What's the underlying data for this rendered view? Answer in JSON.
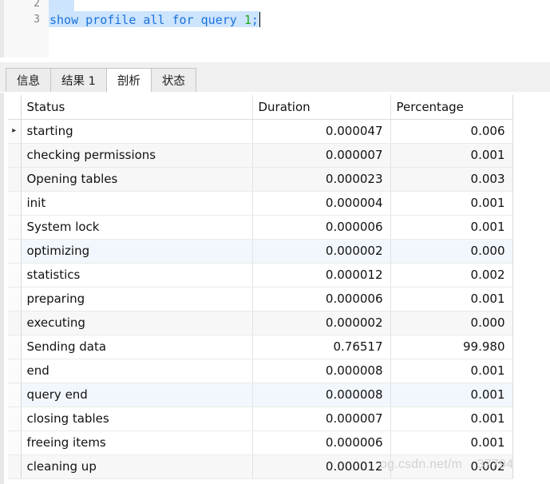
{
  "editor": {
    "line_numbers": [
      "2",
      "3"
    ],
    "query_tokens": {
      "keywords": "show profile all for query ",
      "number": "1",
      "semicolon": ";"
    },
    "query_full": "show profile all for query 1;"
  },
  "tabs": [
    {
      "label": "信息",
      "active": false
    },
    {
      "label": "结果 1",
      "active": false
    },
    {
      "label": "剖析",
      "active": true
    },
    {
      "label": "状态",
      "active": false
    }
  ],
  "grid": {
    "columns": [
      "Status",
      "Duration",
      "Percentage"
    ],
    "row_marker": "▸",
    "rows": [
      {
        "status": "starting",
        "duration": "0.000047",
        "percentage": "0.006",
        "marker": true,
        "highlight": false
      },
      {
        "status": "checking permissions",
        "duration": "0.000007",
        "percentage": "0.001",
        "marker": false,
        "highlight": false
      },
      {
        "status": "Opening tables",
        "duration": "0.000023",
        "percentage": "0.003",
        "marker": false,
        "highlight": false
      },
      {
        "status": "init",
        "duration": "0.000004",
        "percentage": "0.001",
        "marker": false,
        "highlight": false
      },
      {
        "status": "System lock",
        "duration": "0.000006",
        "percentage": "0.001",
        "marker": false,
        "highlight": false
      },
      {
        "status": "optimizing",
        "duration": "0.000002",
        "percentage": "0.000",
        "marker": false,
        "highlight": true
      },
      {
        "status": "statistics",
        "duration": "0.000012",
        "percentage": "0.002",
        "marker": false,
        "highlight": false
      },
      {
        "status": "preparing",
        "duration": "0.000006",
        "percentage": "0.001",
        "marker": false,
        "highlight": false
      },
      {
        "status": "executing",
        "duration": "0.000002",
        "percentage": "0.000",
        "marker": false,
        "highlight": false
      },
      {
        "status": "Sending data",
        "duration": "0.76517",
        "percentage": "99.980",
        "marker": false,
        "highlight": false
      },
      {
        "status": "end",
        "duration": "0.000008",
        "percentage": "0.001",
        "marker": false,
        "highlight": false
      },
      {
        "status": "query end",
        "duration": "0.000008",
        "percentage": "0.001",
        "marker": false,
        "highlight": true
      },
      {
        "status": "closing tables",
        "duration": "0.000007",
        "percentage": "0.001",
        "marker": false,
        "highlight": false
      },
      {
        "status": "freeing items",
        "duration": "0.000006",
        "percentage": "0.001",
        "marker": false,
        "highlight": false
      },
      {
        "status": "cleaning up",
        "duration": "0.000012",
        "percentage": "0.002",
        "marker": false,
        "highlight": false
      }
    ]
  },
  "watermark": {
    "text": "og.csdn.net/m    37794"
  },
  "colors": {
    "sql_keyword": "#1a72dc",
    "sql_number": "#1aab1a",
    "selection": "#cde4fd",
    "row_alt": "#f7f7f7",
    "row_highlight": "#f2f7fd",
    "tab_bar_bg": "#f0f0f0",
    "gutter_bg": "#f8f8f8"
  }
}
